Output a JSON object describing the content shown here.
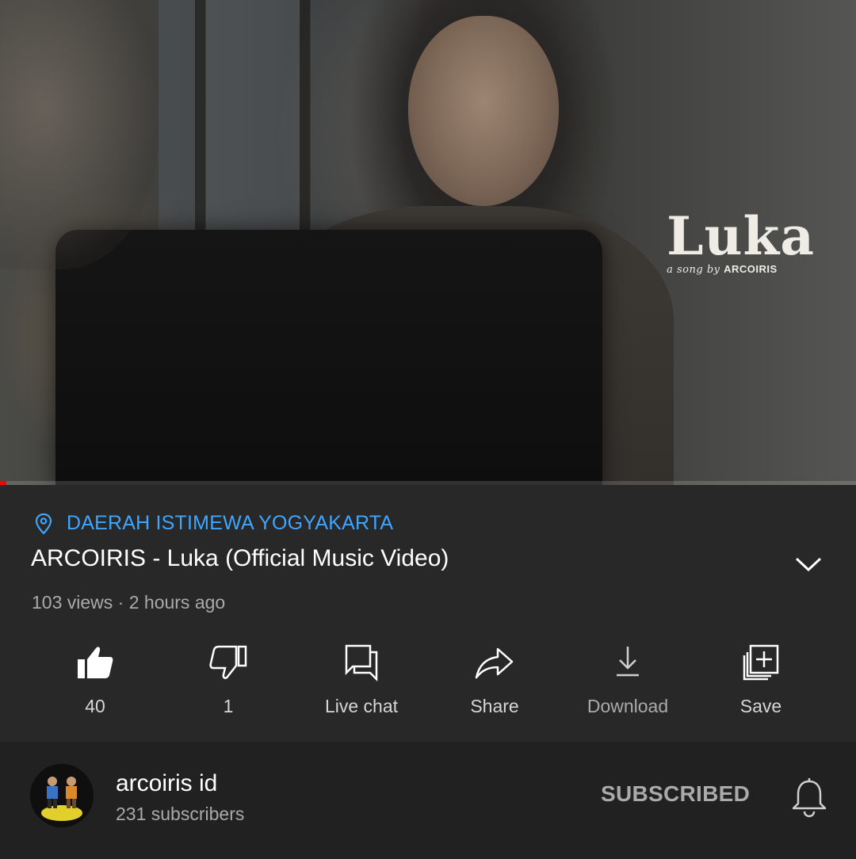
{
  "video": {
    "overlay_title": "Luka",
    "overlay_subtitle_prefix": "a song by",
    "overlay_subtitle_artist": "ARCOIRIS",
    "progress_fraction": 0.007
  },
  "info": {
    "location": "DAERAH ISTIMEWA YOGYAKARTA",
    "title": "ARCOIRIS - Luka (Official Music Video)",
    "meta": "103 views · 2 hours ago"
  },
  "actions": [
    {
      "icon": "thumbs-up-icon",
      "label": "40"
    },
    {
      "icon": "thumbs-down-icon",
      "label": "1"
    },
    {
      "icon": "live-chat-icon",
      "label": "Live chat"
    },
    {
      "icon": "share-icon",
      "label": "Share"
    },
    {
      "icon": "download-icon",
      "label": "Download"
    },
    {
      "icon": "save-icon",
      "label": "Save"
    }
  ],
  "channel": {
    "name": "arcoiris id",
    "subscribers": "231 subscribers",
    "subscribe_state": "SUBSCRIBED",
    "bell_icon": "notification-bell-icon"
  },
  "colors": {
    "accent_red": "#ff0000",
    "link_blue": "#3ea6ff",
    "background": "#282828",
    "channel_background": "#212121"
  }
}
